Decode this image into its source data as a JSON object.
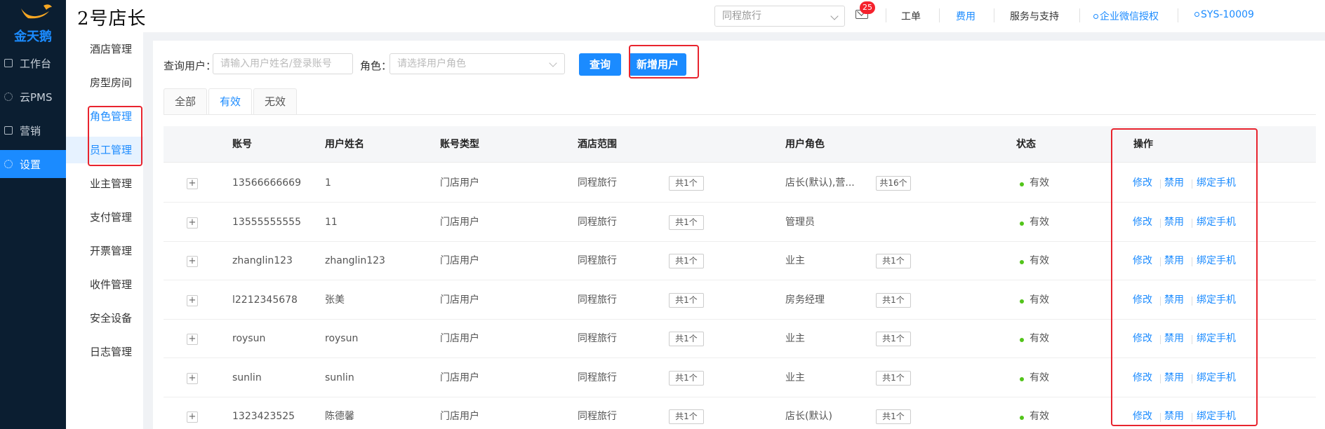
{
  "nav": {
    "logo_text": "金天鹅",
    "items": [
      {
        "label": "工作台",
        "icon": "workbench-icon"
      },
      {
        "label": "云PMS",
        "icon": "gear-icon"
      },
      {
        "label": "营销",
        "icon": "marketing-icon"
      },
      {
        "label": "设置",
        "icon": "settings-gear-icon"
      }
    ]
  },
  "header": {
    "brand": "2号店长",
    "hotel_select": "同程旅行",
    "mail_badge": "25",
    "links": [
      "工单",
      "费用",
      "服务与支持",
      "企业微信授权",
      "SYS-10009"
    ]
  },
  "submenu": {
    "items": [
      "酒店管理",
      "房型房间",
      "角色管理",
      "员工管理",
      "业主管理",
      "支付管理",
      "开票管理",
      "收件管理",
      "安全设备",
      "日志管理"
    ]
  },
  "query": {
    "user_label": "查询用户：",
    "user_placeholder": "请输入用户姓名/登录账号",
    "role_label": "角色：",
    "role_placeholder": "请选择用户角色",
    "query_button": "查询",
    "add_button": "新增用户"
  },
  "tabs": [
    "全部",
    "有效",
    "无效"
  ],
  "table": {
    "columns": [
      "账号",
      "用户姓名",
      "账号类型",
      "酒店范围",
      "用户角色",
      "状态",
      "操作"
    ],
    "rows": [
      {
        "account": "13566666669",
        "name": "1",
        "type": "门店用户",
        "hotel": "同程旅行",
        "hotel_count": "共1个",
        "role": "店长(默认),营...",
        "role_count": "共16个",
        "status": "有效"
      },
      {
        "account": "13555555555",
        "name": "11",
        "type": "门店用户",
        "hotel": "同程旅行",
        "hotel_count": "共1个",
        "role": "管理员",
        "role_count": "",
        "status": "有效"
      },
      {
        "account": "zhanglin123",
        "name": "zhanglin123",
        "type": "门店用户",
        "hotel": "同程旅行",
        "hotel_count": "共1个",
        "role": "业主",
        "role_count": "共1个",
        "status": "有效"
      },
      {
        "account": "l2212345678",
        "name": "张美",
        "type": "门店用户",
        "hotel": "同程旅行",
        "hotel_count": "共1个",
        "role": "房务经理",
        "role_count": "共1个",
        "status": "有效"
      },
      {
        "account": "roysun",
        "name": "roysun",
        "type": "门店用户",
        "hotel": "同程旅行",
        "hotel_count": "共1个",
        "role": "业主",
        "role_count": "共1个",
        "status": "有效"
      },
      {
        "account": "sunlin",
        "name": "sunlin",
        "type": "门店用户",
        "hotel": "同程旅行",
        "hotel_count": "共1个",
        "role": "业主",
        "role_count": "共1个",
        "status": "有效"
      },
      {
        "account": "1323423525",
        "name": "陈德馨",
        "type": "门店用户",
        "hotel": "同程旅行",
        "hotel_count": "共1个",
        "role": "店长(默认)",
        "role_count": "共1个",
        "status": "有效"
      }
    ],
    "ops": [
      "修改",
      "禁用",
      "绑定手机"
    ],
    "expand_symbol": "+"
  },
  "colors": {
    "primary": "#1b8bff",
    "nav_bg": "#0b1e31",
    "highlight": "#e8242e",
    "status_ok": "#52c41a",
    "badge": "#f5222d"
  }
}
